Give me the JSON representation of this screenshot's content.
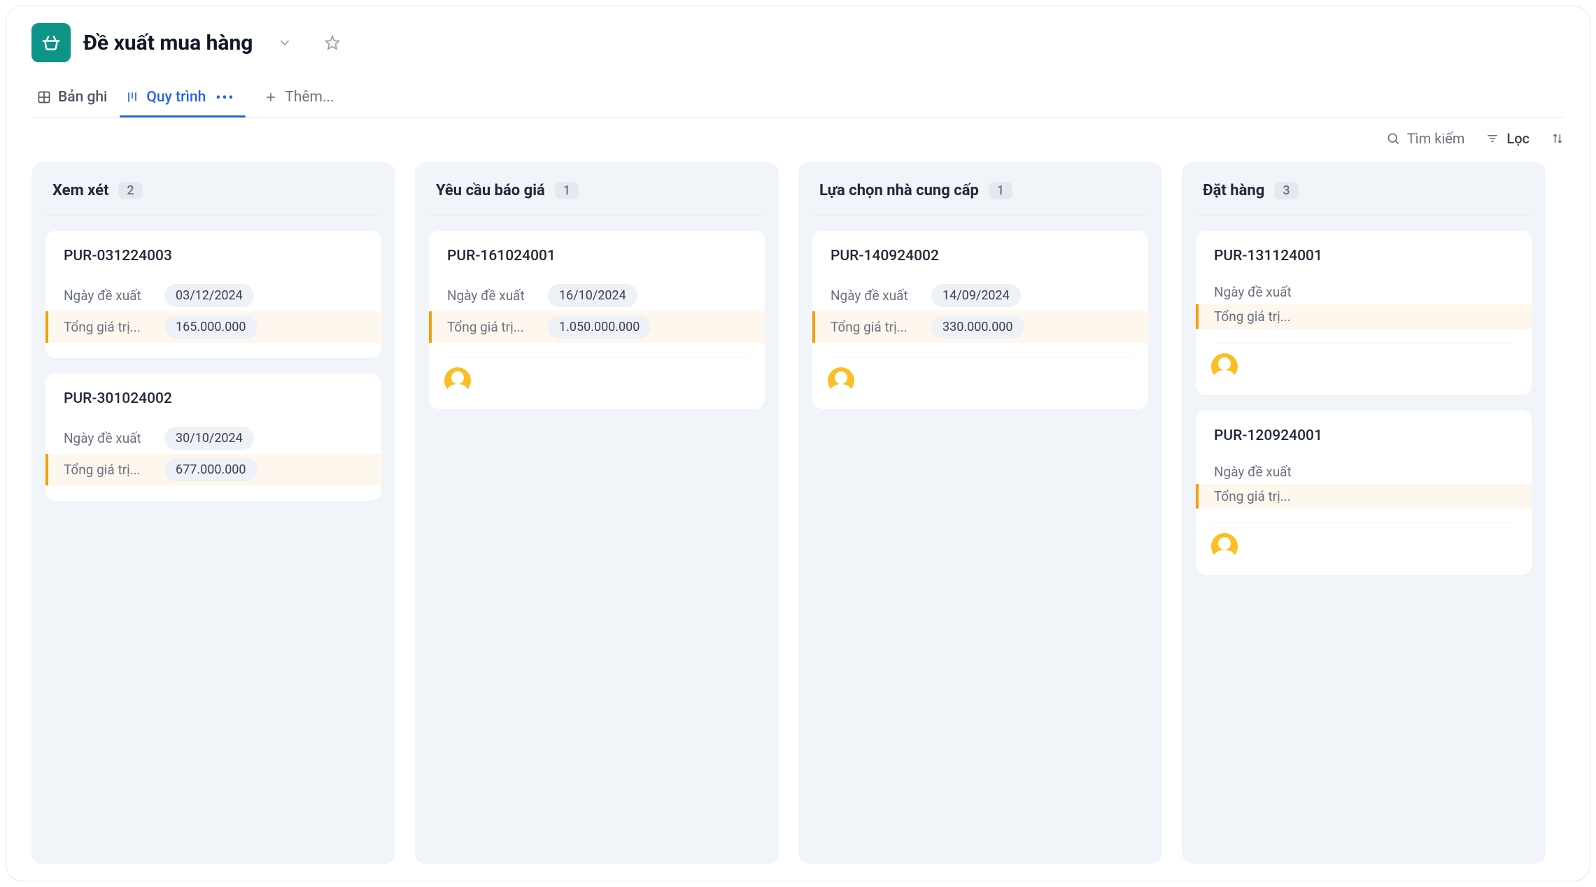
{
  "header": {
    "title": "Đề xuất mua hàng"
  },
  "tabs": {
    "records": "Bản ghi",
    "process": "Quy trình",
    "add": "Thêm..."
  },
  "toolbar": {
    "search": "Tìm kiếm",
    "filter": "Lọc"
  },
  "fieldLabels": {
    "requestDate": "Ngày đề xuất",
    "totalValue": "Tổng giá trị..."
  },
  "columns": [
    {
      "title": "Xem xét",
      "count": "2",
      "cards": [
        {
          "id": "PUR-031224003",
          "date": "03/12/2024",
          "total": "165.000.000",
          "showAvatar": false
        },
        {
          "id": "PUR-301024002",
          "date": "30/10/2024",
          "total": "677.000.000",
          "showAvatar": false
        }
      ]
    },
    {
      "title": "Yêu cầu báo giá",
      "count": "1",
      "cards": [
        {
          "id": "PUR-161024001",
          "date": "16/10/2024",
          "total": "1.050.000.000",
          "showAvatar": true
        }
      ]
    },
    {
      "title": "Lựa chọn nhà cung cấp",
      "count": "1",
      "cards": [
        {
          "id": "PUR-140924002",
          "date": "14/09/2024",
          "total": "330.000.000",
          "showAvatar": true
        }
      ]
    },
    {
      "title": "Đặt hàng",
      "count": "3",
      "cards": [
        {
          "id": "PUR-131124001",
          "date": "",
          "total": "",
          "showAvatar": true
        },
        {
          "id": "PUR-120924001",
          "date": "",
          "total": "",
          "showAvatar": true
        }
      ]
    }
  ]
}
